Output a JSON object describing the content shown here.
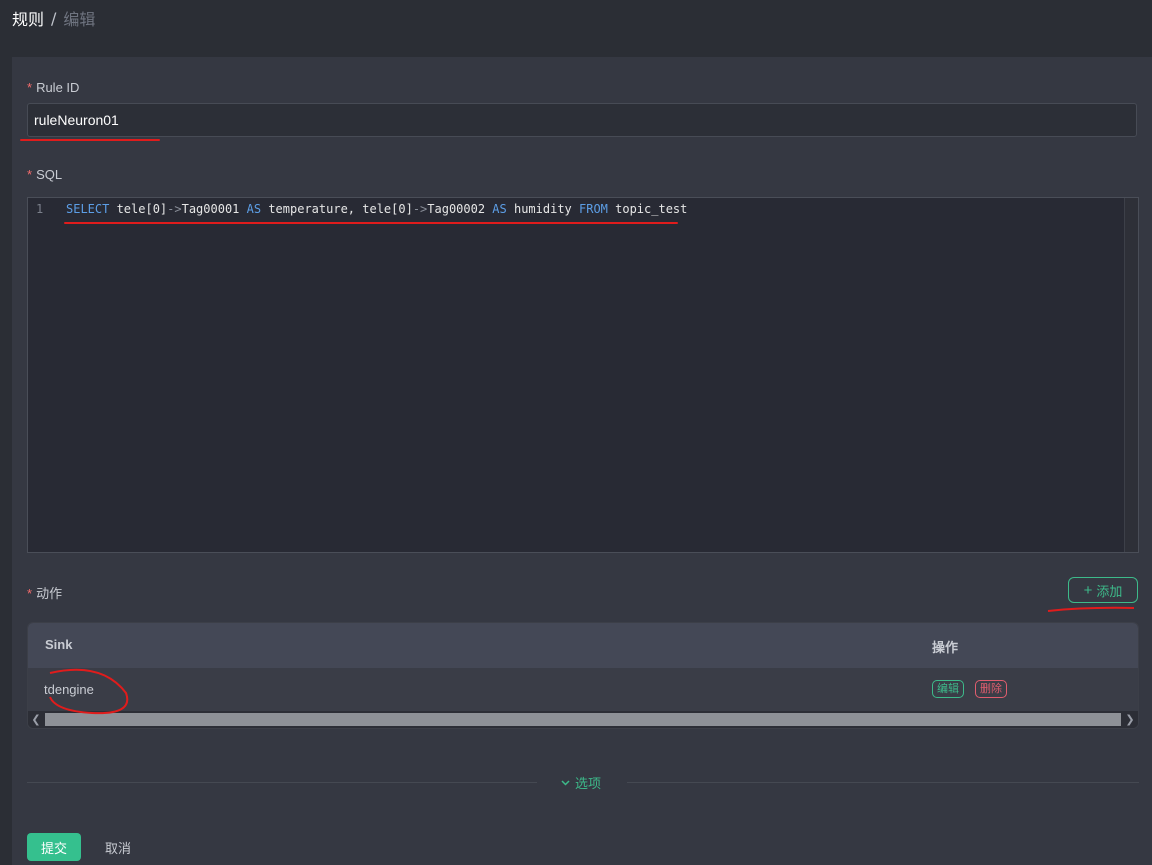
{
  "breadcrumb": {
    "current": "规则",
    "separator": "/",
    "next": "编辑"
  },
  "form": {
    "rule_id": {
      "label": "Rule ID",
      "required_mark": "*",
      "value": "ruleNeuron01"
    },
    "sql": {
      "label": "SQL",
      "required_mark": "*",
      "line_number": "1",
      "tokens": [
        {
          "t": "SELECT",
          "kw": true
        },
        {
          "t": " tele[0]",
          "kw": false
        },
        {
          "t": "->",
          "op": true
        },
        {
          "t": "Tag00001 ",
          "kw": false
        },
        {
          "t": "AS",
          "kw": true
        },
        {
          "t": " temperature, tele[0]",
          "kw": false
        },
        {
          "t": "->",
          "op": true
        },
        {
          "t": "Tag00002 ",
          "kw": false
        },
        {
          "t": "AS",
          "kw": true
        },
        {
          "t": " humidity ",
          "kw": false
        },
        {
          "t": "FROM",
          "kw": true
        },
        {
          "t": " topic_test",
          "kw": false
        }
      ]
    },
    "actions": {
      "label": "动作",
      "required_mark": "*",
      "add_button": {
        "plus": "+",
        "label": "添加"
      },
      "table": {
        "columns": [
          "Sink",
          "操作"
        ],
        "rows": [
          {
            "sink": "tdengine",
            "edit": "编辑",
            "delete": "删除"
          }
        ]
      }
    },
    "options": {
      "label": "选项"
    },
    "submit_label": "提交",
    "cancel_label": "取消"
  },
  "colors": {
    "accent": "#3dba8a",
    "danger": "#e05d6e",
    "annotation": "#e01c1c"
  },
  "icons": {
    "scroll_left": "chevron-left-icon",
    "scroll_right": "chevron-right-icon",
    "options_toggle": "chevron-down-icon"
  }
}
